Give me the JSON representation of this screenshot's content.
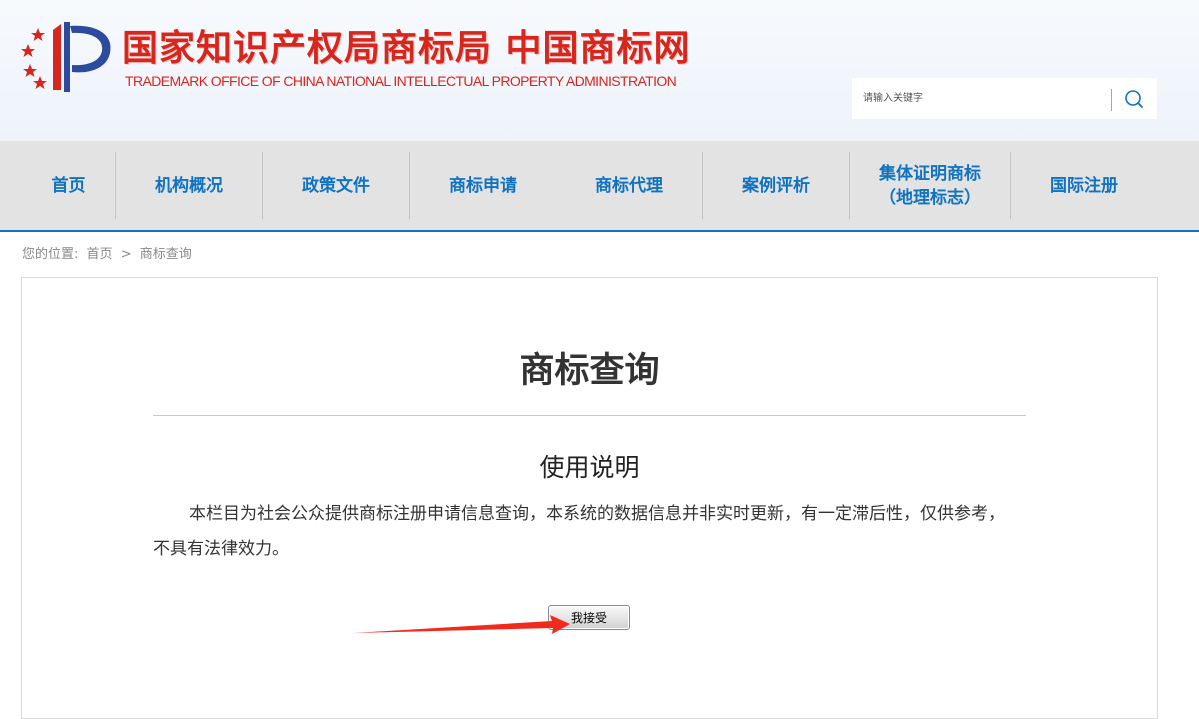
{
  "header": {
    "title_cn": "国家知识产权局商标局 中国商标网",
    "title_en": "TRADEMARK OFFICE OF CHINA NATIONAL INTELLECTUAL PROPERTY ADMINISTRATION",
    "logo_icon": "trademark-office-emblem",
    "search": {
      "placeholder": "请输入关键字",
      "value": "",
      "button_icon": "search-icon"
    }
  },
  "nav": {
    "items": [
      {
        "label": "首页"
      },
      {
        "label": "机构概况"
      },
      {
        "label": "政策文件"
      },
      {
        "label": "商标申请"
      },
      {
        "label": "商标代理"
      },
      {
        "label": "案例评析"
      },
      {
        "label": "集体证明商标",
        "label2": "（地理标志）"
      },
      {
        "label": "国际注册"
      }
    ]
  },
  "breadcrumb": {
    "prefix": "您的位置:",
    "home": "首页",
    "separator": ">",
    "current": "商标查询"
  },
  "main": {
    "title": "商标查询",
    "usage_heading": "使用说明",
    "usage_text": "本栏目为社会公众提供商标注册申请信息查询，本系统的数据信息并非实时更新，有一定滞后性，仅供参考，不具有法律效力。",
    "accept_button": "我接受"
  },
  "colors": {
    "brand_red": "#d7261d",
    "nav_blue": "#1173c0",
    "nav_bg": "#e3e3e3",
    "annotation_red": "#f22a1e"
  }
}
